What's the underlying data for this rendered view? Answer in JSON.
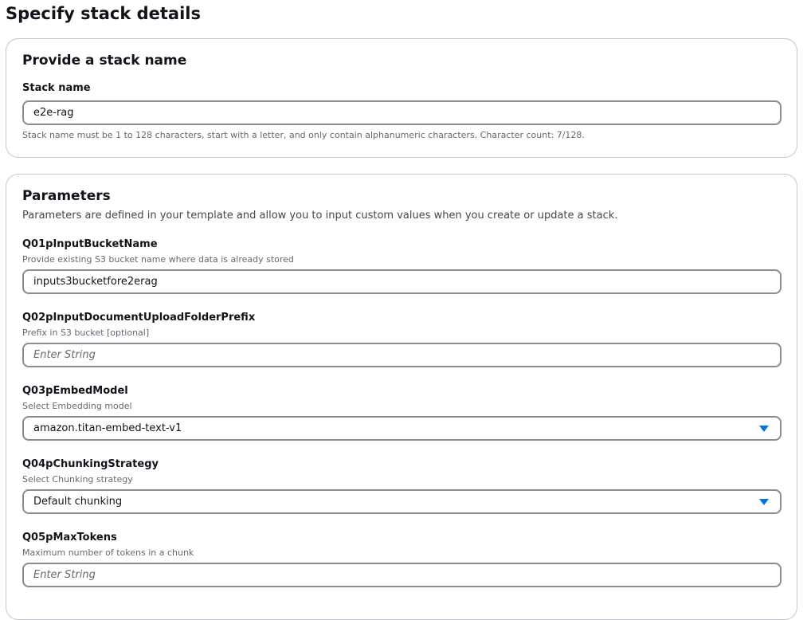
{
  "page_title": "Specify stack details",
  "stack_name_section": {
    "heading": "Provide a stack name",
    "label": "Stack name",
    "value": "e2e-rag",
    "constraint": "Stack name must be 1 to 128 characters, start with a letter, and only contain alphanumeric characters. Character count: 7/128."
  },
  "parameters_section": {
    "heading": "Parameters",
    "description": "Parameters are defined in your template and allow you to input custom values when you create or update a stack.",
    "params": [
      {
        "label": "Q01pInputBucketName",
        "description": "Provide existing S3 bucket name where data is already stored",
        "value": "inputs3bucketfore2erag",
        "placeholder": ""
      },
      {
        "label": "Q02pInputDocumentUploadFolderPrefix",
        "description": "Prefix in S3 bucket [optional]",
        "value": "",
        "placeholder": "Enter String"
      },
      {
        "label": "Q03pEmbedModel",
        "description": "Select Embedding model",
        "selected": "amazon.titan-embed-text-v1",
        "icon": "caret-down-icon"
      },
      {
        "label": "Q04pChunkingStrategy",
        "description": "Select Chunking strategy",
        "selected": "Default chunking",
        "icon": "caret-down-icon"
      },
      {
        "label": "Q05pMaxTokens",
        "description": "Maximum number of tokens in a chunk",
        "value": "",
        "placeholder": "Enter String"
      }
    ]
  },
  "colors": {
    "accent": "#0972d3",
    "border": "#8c8c94",
    "panel_border": "#c6c6cd"
  }
}
